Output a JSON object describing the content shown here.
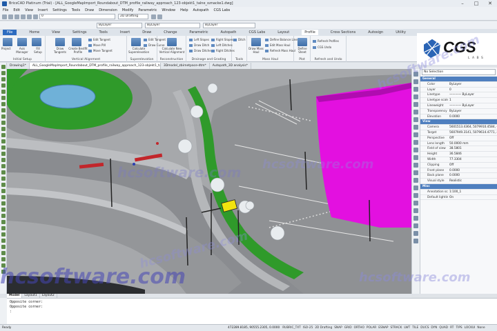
{
  "window": {
    "title": "BricsCAD Platinum (Trial) - [ALL_GoogleMapImport_Roundabout_DTM_profile_railway_approach_123-objekt1_talne_oznacke1.dwg]",
    "controls": [
      "–",
      "□",
      "✕"
    ]
  },
  "menu": [
    "File",
    "Edit",
    "View",
    "Insert",
    "Settings",
    "Tools",
    "Draw",
    "Dimension",
    "Modify",
    "Parametric",
    "Window",
    "Help",
    "Autopath",
    "CGS Labs"
  ],
  "quick_toolbar": {
    "layer_select": "0",
    "workspace_select": "2D Drafting",
    "color_select": "ByLayer",
    "linetype_select": "ByLayer",
    "lineweight_select": "ByLayer"
  },
  "ribbon_tabs": [
    "File",
    "Home",
    "View",
    "Settings",
    "Tools",
    "Insert",
    "Draw",
    "Change",
    "Parametric",
    "Autopath",
    "CGS Labs",
    "Layout",
    "Profile",
    "Cross Sections",
    "Autosign",
    "Utility"
  ],
  "ribbon_active_tab": "Profile",
  "ribbon_groups": [
    {
      "name": "Initial Setup",
      "buttons": [
        "Project",
        "Axis Manager",
        "Fill Setup"
      ]
    },
    {
      "name": "Vertical Alignment",
      "buttons": [
        "Draw Tangents",
        "Create Bestfit Profile"
      ],
      "small": [
        "Edit Tangent",
        "Move PVI",
        "Move Tangent"
      ]
    },
    {
      "name": "Superelevation",
      "buttons": [
        "Calculate Superelevation"
      ],
      "small": [
        "Edit Tangent",
        "Draw Curve"
      ]
    },
    {
      "name": "Reconstruction",
      "buttons": [
        "Calculate New Vertical Alignment"
      ]
    },
    {
      "name": "Drainage and Grading",
      "small": [
        "Left Slopes",
        "Draw Ditch",
        "Draw Ditches",
        "Right Slopes",
        "Left Ditches",
        "Right Ditches"
      ]
    },
    {
      "name": "Tools",
      "small": [
        "Ditch",
        "Tools"
      ]
    },
    {
      "name": "Mass Haul",
      "buttons": [
        "Draw Mass Haul"
      ],
      "small": [
        "Define Balance Line",
        "Edit Mass Haul",
        "Refresh Mass Haul"
      ]
    },
    {
      "name": "Plot",
      "buttons": [
        "Define Sheet"
      ]
    },
    {
      "name": "Refresh and Undo",
      "small": [
        "Refresh Profiles",
        "CGS Undo"
      ]
    }
  ],
  "logo": {
    "name": "CGS",
    "sub": "L A B S"
  },
  "doc_tabs": [
    "Drawing1*",
    "ALL_GoogleMapImport_Roundabout_DTM_profile_railway_approach_123-objekt1_talne_oznacke1*",
    "3Dmodel_zbirnetpace-dtm*",
    "Autopath_3D analysis*"
  ],
  "doc_tab_active": 1,
  "properties": {
    "selection": "No Selection",
    "rows": [
      {
        "section": "General"
      },
      {
        "k": "Color",
        "v": "ByLayer"
      },
      {
        "k": "Layer",
        "v": "0"
      },
      {
        "k": "Linetype",
        "v": "———— ByLayer"
      },
      {
        "k": "Linetype scale",
        "v": "1"
      },
      {
        "k": "Lineweight",
        "v": "———— ByLayer"
      },
      {
        "k": "Transparency",
        "v": "ByLayer"
      },
      {
        "k": "Elevation",
        "v": "0.0000"
      },
      {
        "section": "View"
      },
      {
        "k": "Camera",
        "v": "5601513.4364, 5079910.4584, -463716.3"
      },
      {
        "k": "Target",
        "v": "5607949.3141, 5079614.4771, 463716.3"
      },
      {
        "k": "Perspective",
        "v": "Off"
      },
      {
        "k": "Lens length",
        "v": "50.0000 mm"
      },
      {
        "k": "Field of view",
        "v": "38.5801"
      },
      {
        "k": "Height",
        "v": "36.5846"
      },
      {
        "k": "Width",
        "v": "77.3304"
      },
      {
        "k": "Clipping",
        "v": "Off"
      },
      {
        "k": "Front plane",
        "v": "0.0000"
      },
      {
        "k": "Back plane",
        "v": "0.0000"
      },
      {
        "k": "Visual style",
        "v": "Realistic"
      },
      {
        "section": "Misc"
      },
      {
        "k": "Annotation scale",
        "v": "1:100_1"
      },
      {
        "k": "Default lighting",
        "v": "On"
      }
    ]
  },
  "layout_tabs": [
    "Model",
    "Layout1",
    "Layout2"
  ],
  "command_line": [
    "Opposite corner:",
    "Opposite corner:",
    ":"
  ],
  "status": {
    "ready": "Ready",
    "coords": "472289.8185, 90555.2305, 0.0000",
    "toggles": [
      "RUBRIC_TXT",
      "ISO-25",
      "2D Drafting",
      "SNAP",
      "GRID",
      "ORTHO",
      "POLAR",
      "ESNAP",
      "STRACK",
      "LWT",
      "TILE",
      "DUCS",
      "DYN",
      "QUAD",
      "RT",
      "TIPS",
      "LOCKUI",
      "None"
    ]
  },
  "watermark": "hcsoftware.com",
  "colors": {
    "grass": "#2f9a2a",
    "asphalt": "#8e9094",
    "building": "#e310e0",
    "water": "#6fb1d8",
    "bikelane": "#c2262b",
    "accent": "#2d6cc0"
  }
}
